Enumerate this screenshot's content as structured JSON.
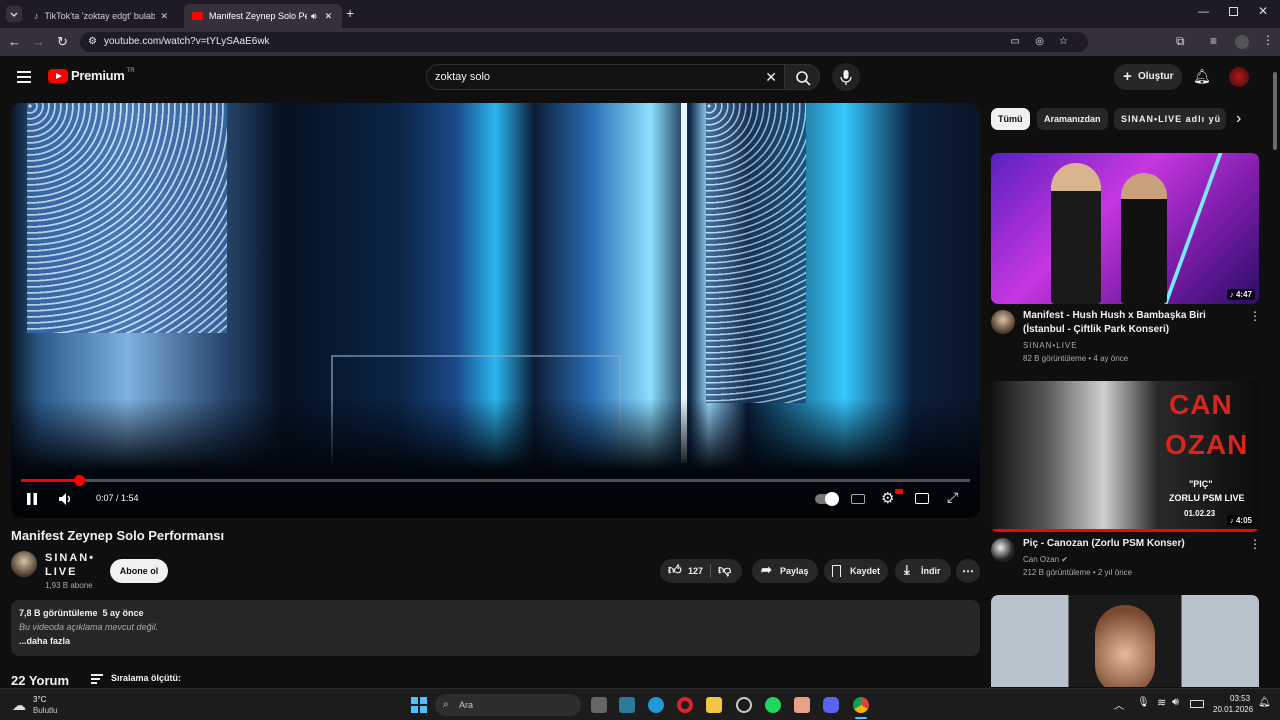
{
  "browser": {
    "tabs": [
      {
        "title": "TikTok'ta 'zoktay edgt' bulabili..."
      },
      {
        "title": "Manifest Zeynep Solo Perfo..."
      }
    ],
    "url": "youtube.com/watch?v=tYLySAaE6wk"
  },
  "header": {
    "logo": "Premium",
    "logo_sup": "TR",
    "search_value": "zoktay solo",
    "create_label": "Oluştur"
  },
  "player": {
    "time": "0:07 / 1:54",
    "progress": 0.061
  },
  "video": {
    "title": "Manifest Zeynep Solo Performansı",
    "channel": "SINAN• LIVE",
    "subscribers": "1,93 B abone",
    "subscribe_label": "Abone ol",
    "likes": "127",
    "share_label": "Paylaş",
    "save_label": "Kaydet",
    "download_label": "İndir"
  },
  "description": {
    "stats": "7,8 B görüntüleme  5 ay önce",
    "text": "Bu videoda açıklama mevcut değil.",
    "more": "...daha fazla"
  },
  "comments": {
    "count": "22 Yorum",
    "sort_label": "Sıralama ölçütü:"
  },
  "sidebar": {
    "chips": [
      "Tümü",
      "Aramanızdan",
      "SINAN•LIVE adlı yü"
    ],
    "videos": [
      {
        "title": "Manifest - Hush Hush x Bambaşka Biri (İstanbul - Çiftlik Park Konseri)",
        "channel": "SINAN•LIVE",
        "meta": "82 B görüntüleme • 4 ay önce",
        "duration": "4:47"
      },
      {
        "title": "Piç - Canozan (Zorlu PSM Konser)",
        "channel": "Can Ozan",
        "meta": "212 B görüntüleme • 2 yıl önce",
        "duration": "4:05",
        "thumb_text": [
          "CAN",
          "OZAN",
          "\"PIÇ\"",
          "ZORLU PSM LIVE",
          "01.02.23"
        ]
      }
    ]
  },
  "taskbar": {
    "weather_temp": "3°C",
    "weather_desc": "Bulutlu",
    "search_label": "Ara",
    "time": "03:53",
    "date": "20.01.2026"
  },
  "colors": {
    "accent": "#ff0000",
    "bg": "#0f0f0f",
    "chip_active": "#f1f1f1"
  }
}
